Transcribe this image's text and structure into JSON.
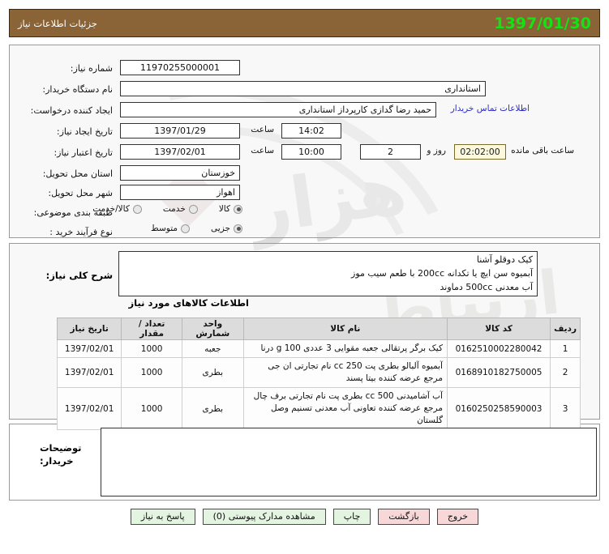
{
  "titlebar": {
    "title": "جزئیات اطلاعات نیاز",
    "date": "1397/01/30"
  },
  "form": {
    "need_number_label": "شماره نیاز:",
    "need_number_value": "11970255000001",
    "buyer_org_label": "نام دستگاه خریدار:",
    "buyer_org_value": "استانداری",
    "requester_label": "ایجاد کننده درخواست:",
    "requester_value": "حمید رضا گدازی کارپرداز استانداری",
    "contact_link": "اطلاعات تماس خریدار",
    "create_date_label": "تاریخ ایجاد نیاز:",
    "create_date_value": "1397/01/29",
    "create_time_label": "ساعت",
    "create_time_value": "14:02",
    "expire_date_label": "تاریخ اعتبار نیاز:",
    "expire_date_value": "1397/02/01",
    "expire_time_label": "ساعت",
    "expire_time_value": "10:00",
    "days_value": "2",
    "days_label": "روز و",
    "countdown_value": "02:02:00",
    "remaining_label": "ساعت باقی مانده",
    "province_label": "استان محل تحویل:",
    "province_value": "خوزستان",
    "city_label": "شهر محل تحویل:",
    "city_value": "اهواز",
    "category_label": "طبقه بندی موضوعی:",
    "category_options": [
      {
        "label": "کالا",
        "checked": true
      },
      {
        "label": "خدمت",
        "checked": false
      },
      {
        "label": "کالا/خدمت",
        "checked": false
      }
    ],
    "process_label": "نوع فرآیند خرید :",
    "process_options": [
      {
        "label": "جزیی",
        "checked": true
      },
      {
        "label": "متوسط",
        "checked": false
      }
    ]
  },
  "description": {
    "label": "شرح کلی نیاز:",
    "line1": "کیک دوقلو آشنا",
    "line2": "آبمیوه سن ایچ یا تکدانه 200cc با طعم سیب موز",
    "line3": "آب معدنی 500cc دماوند"
  },
  "goods": {
    "heading": "اطلاعات کالاهای مورد نیاز",
    "columns": [
      "ردیف",
      "کد کالا",
      "نام کالا",
      "واحد شمارش",
      "تعداد / مقدار",
      "تاریخ نیاز"
    ],
    "rows": [
      {
        "radif": "1",
        "code": "0162510002280042",
        "name": "کیک برگر پرتقالی جعبه مقوایی 3 عددی 100 g درنا",
        "unit": "جعبه",
        "qty": "1000",
        "date": "1397/02/01"
      },
      {
        "radif": "2",
        "code": "0168910182750005",
        "name": "آبمیوه آلبالو بطری پت 250 cc نام تجارتی ان جی مرجع عرضه کننده بیتا پسند",
        "unit": "بطری",
        "qty": "1000",
        "date": "1397/02/01"
      },
      {
        "radif": "3",
        "code": "0160250258590003",
        "name": "آب آشامیدنی 500 cc بطری پت نام تجارتی برف چال مرجع عرضه کننده تعاونی آب معدنی تسنیم وصل گلستان",
        "unit": "بطری",
        "qty": "1000",
        "date": "1397/02/01"
      }
    ]
  },
  "notes": {
    "label_line1": "توضیحات",
    "label_line2": "خریدار:",
    "value": ""
  },
  "footer": {
    "buttons": [
      {
        "label": "پاسخ به نیاز",
        "style": "green"
      },
      {
        "label": "مشاهده مدارک پیوستی (0)",
        "style": "green"
      },
      {
        "label": "چاپ",
        "style": "green"
      },
      {
        "label": "بازگشت",
        "style": "red"
      },
      {
        "label": "خروج",
        "style": "red"
      }
    ]
  },
  "watermark": {
    "text1": "هزار",
    "text2": "ارتباط"
  },
  "colors": {
    "titlebar_bg": "#8a6436",
    "title_date": "#15e215",
    "link": "#2b2bc8",
    "countdown_bg": "#fbf8dd",
    "btn_green": "#e3f5e0",
    "btn_red": "#f7d7d7"
  }
}
